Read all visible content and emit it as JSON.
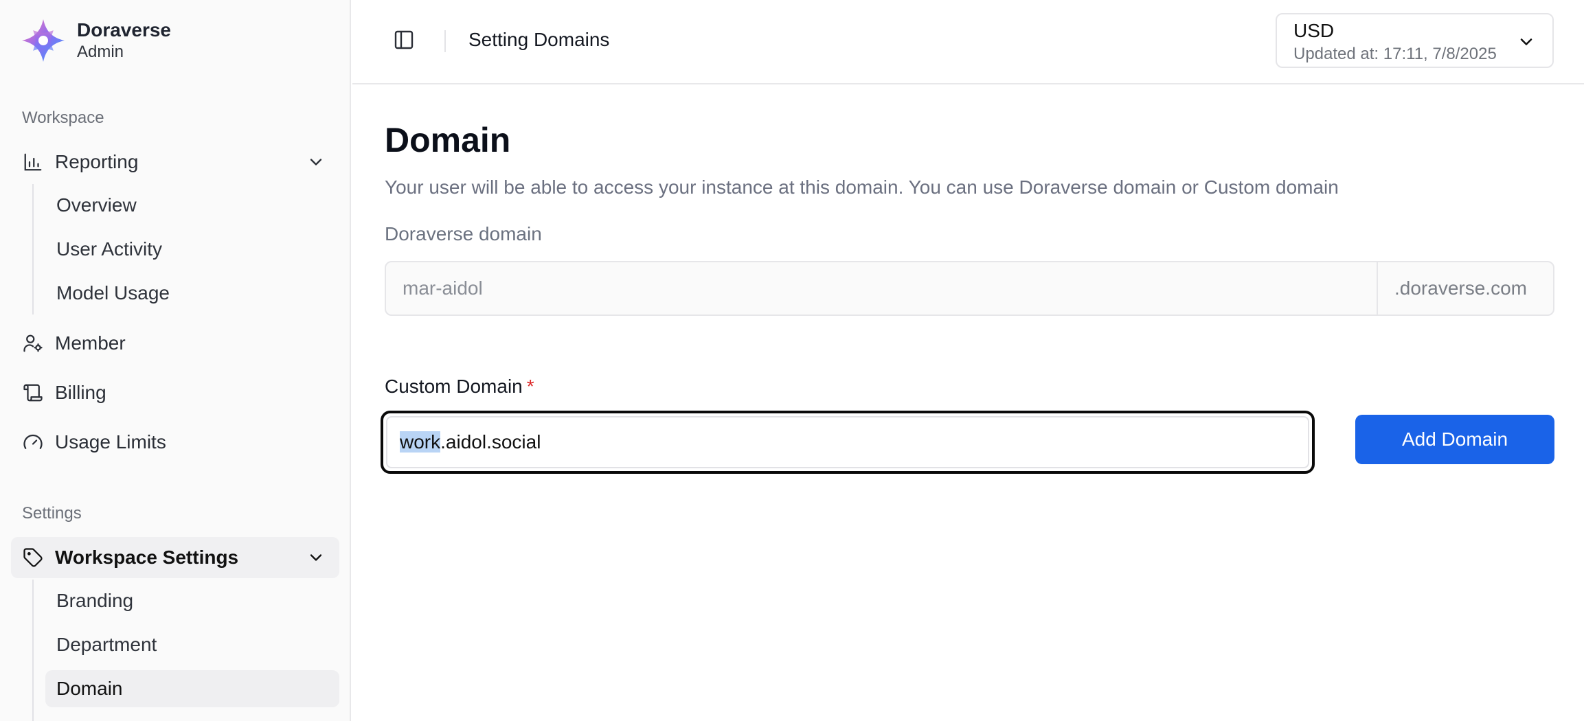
{
  "brand": {
    "name": "Doraverse",
    "role": "Admin"
  },
  "sidebar": {
    "workspace_label": "Workspace",
    "reporting": {
      "label": "Reporting",
      "items": [
        "Overview",
        "User Activity",
        "Model Usage"
      ]
    },
    "member_label": "Member",
    "billing_label": "Billing",
    "usage_limits_label": "Usage Limits",
    "settings_label": "Settings",
    "workspace_settings": {
      "label": "Workspace Settings",
      "items": [
        "Branding",
        "Department",
        "Domain"
      ],
      "active": "Domain"
    }
  },
  "header": {
    "title": "Setting Domains",
    "currency": {
      "code": "USD",
      "updated": "Updated at: 17:11, 7/8/2025"
    }
  },
  "main": {
    "title": "Domain",
    "description": "Your user will be able to access your instance at this domain. You can use Doraverse domain or Custom domain",
    "doraverse_domain": {
      "label": "Doraverse domain",
      "value": "mar-aidol",
      "suffix": ".doraverse.com"
    },
    "custom_domain": {
      "label": "Custom Domain",
      "required_mark": "*",
      "value_selected": "work",
      "value_rest": ".aidol.social"
    },
    "add_button": "Add Domain"
  },
  "colors": {
    "accent": "#1a63e8",
    "required": "#dc2626",
    "selection": "#b9d4f5"
  }
}
